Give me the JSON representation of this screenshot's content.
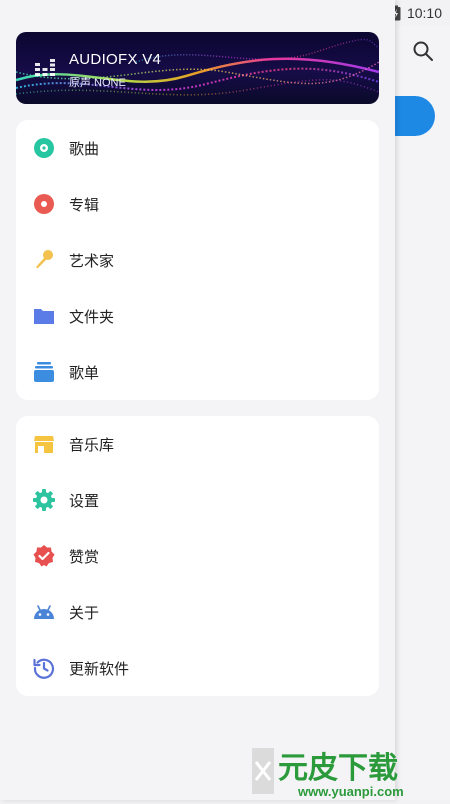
{
  "status_bar": {
    "time": "10:10"
  },
  "header": {
    "title": "AUDIOFX V4",
    "subtitle": "原声 NONE"
  },
  "menu_group_1": [
    {
      "label": "歌曲"
    },
    {
      "label": "专辑"
    },
    {
      "label": "艺术家"
    },
    {
      "label": "文件夹"
    },
    {
      "label": "歌单"
    }
  ],
  "menu_group_2": [
    {
      "label": "音乐库"
    },
    {
      "label": "设置"
    },
    {
      "label": "赞赏"
    },
    {
      "label": "关于"
    },
    {
      "label": "更新软件"
    }
  ],
  "watermark": {
    "main": "元皮下载",
    "url": "www.yuanpi.com"
  },
  "colors": {
    "accent": "#1e88e5",
    "songs": "#26c6a0",
    "albums": "#e85a52",
    "artists": "#f2c14e",
    "folders": "#5b7be6",
    "playlists": "#3c8de0",
    "library": "#f5c542",
    "settings": "#2ec4a0",
    "donate": "#e85050",
    "about": "#4b84d6",
    "update": "#5b72d8"
  }
}
